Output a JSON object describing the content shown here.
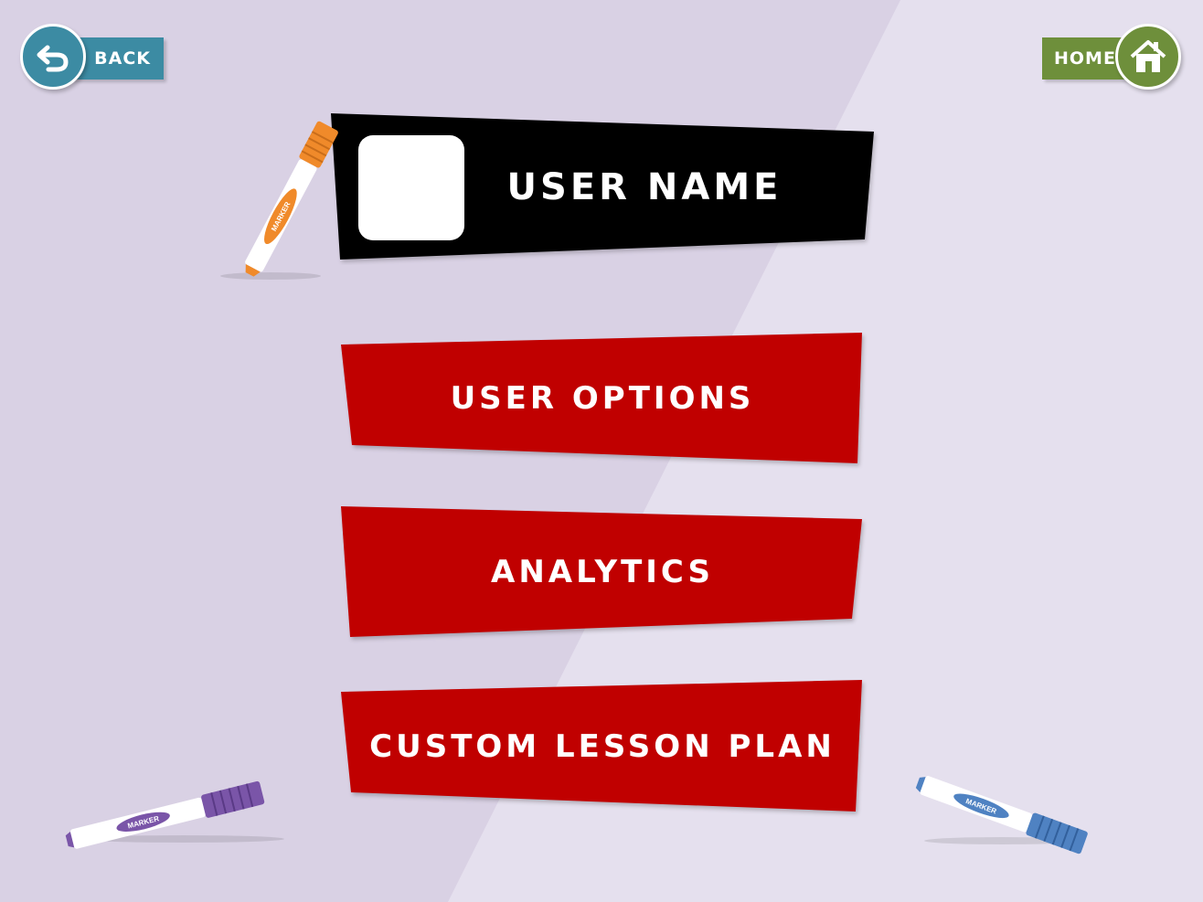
{
  "colors": {
    "background_left": "#d9d1e4",
    "background_right": "#e5e0ee",
    "back_accent": "#3c8ba3",
    "home_accent": "#6e8f3b",
    "menu_red": "#c00000",
    "header_black": "#000000",
    "marker_orange": "#f08a2a",
    "marker_purple": "#7a55a8",
    "marker_blue": "#4f82c2"
  },
  "nav": {
    "back_label": "BACK",
    "back_icon": "undo-arrow-icon",
    "home_label": "HOME",
    "home_icon": "house-icon"
  },
  "header": {
    "user_name": "USER NAME",
    "avatar": "avatar-placeholder"
  },
  "menu": {
    "items": [
      {
        "label": "USER OPTIONS"
      },
      {
        "label": "ANALYTICS"
      },
      {
        "label": "CUSTOM LESSON PLAN"
      }
    ]
  },
  "decorations": {
    "marker_text": "MARKER"
  }
}
